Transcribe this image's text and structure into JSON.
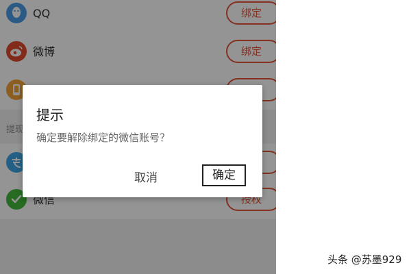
{
  "accounts": [
    {
      "label": "QQ",
      "button": "绑定",
      "icon": "qq-icon",
      "color": "#4a9de6"
    },
    {
      "label": "微博",
      "button": "绑定",
      "icon": "weibo-icon",
      "color": "#e04a2e"
    },
    {
      "label": "",
      "button": "",
      "icon": "phone-icon",
      "color": "#f2a33a"
    }
  ],
  "section2": {
    "label": "提现",
    "items": [
      {
        "label": "",
        "button": "",
        "icon": "alipay-icon",
        "color": "#3ea6e6"
      },
      {
        "label": "微信",
        "button": "授权",
        "icon": "wechat-icon",
        "color": "#43b83a"
      }
    ]
  },
  "dialog": {
    "title": "提示",
    "message": "确定要解除绑定的微信账号？",
    "cancel": "取消",
    "confirm": "确定"
  },
  "watermark": "头条 @苏墨929",
  "colors": {
    "accent": "#e4553a",
    "overlay": "rgba(0,0,0,0.42)"
  }
}
